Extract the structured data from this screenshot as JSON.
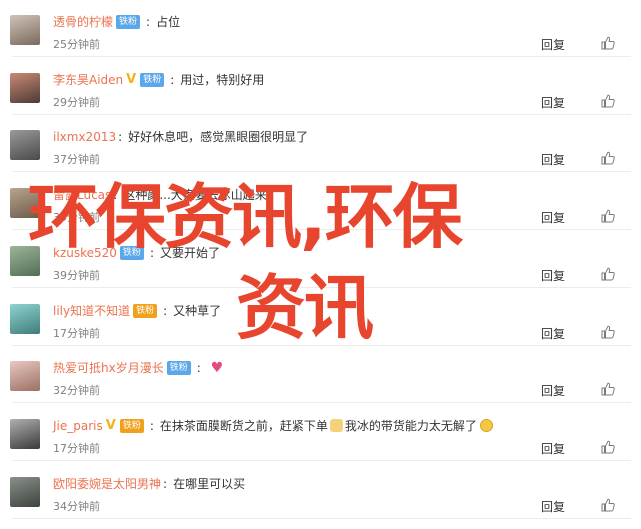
{
  "comments": [
    {
      "username": "透骨的柠檬",
      "badge": "铁粉",
      "text": "占位",
      "time": "25分钟前",
      "reply_label": "回复",
      "like_label": "",
      "avatar_colors": [
        "#cfc3b8",
        "#7b6a5d"
      ]
    },
    {
      "username": "李东昊Aiden",
      "vip": "V",
      "badge": "铁粉",
      "text": "用过，特别好用",
      "time": "29分钟前",
      "reply_label": "回复",
      "like_label": "",
      "avatar_colors": [
        "#c98a76",
        "#4e3a33"
      ]
    },
    {
      "username": "ilxmx2013",
      "text": "好好休息吧，感觉黑眼圈很明显了",
      "time": "37分钟前",
      "reply_label": "回复",
      "like_label": "",
      "avatar_colors": [
        "#9a9a9a",
        "#4a4a4a"
      ]
    },
    {
      "username": "雷露Lucas",
      "text": "这种颜...大家要去冰山起来",
      "time": "39分钟前",
      "reply_label": "回复",
      "like_label": "",
      "avatar_colors": [
        "#b7a490",
        "#6d5a48"
      ]
    },
    {
      "username": "kzuske520",
      "badge": "铁粉",
      "text": "又要开始了",
      "time": "39分钟前",
      "reply_label": "回复",
      "like_label": "",
      "avatar_colors": [
        "#9ab59a",
        "#546e55"
      ]
    },
    {
      "username": "lily知道不知道",
      "badge": "铁粉",
      "text": "又种草了",
      "time": "17分钟前",
      "reply_label": "回复",
      "like_label": "",
      "avatar_colors": [
        "#8fd3d0",
        "#3f7d7a"
      ]
    },
    {
      "username": "热爱可抵hx岁月漫长",
      "badge": "铁粉",
      "text": "",
      "time": "32分钟前",
      "reply_label": "回复",
      "like_label": "",
      "avatar_colors": [
        "#e8c9c0",
        "#9b6f64"
      ]
    },
    {
      "username": "Jie_paris",
      "vip": "V",
      "badge": "铁粉",
      "text": "在抹茶面膜断货之前，赶紧下单",
      "text2": "我冰的带货能力太无解了",
      "time": "17分钟前",
      "reply_label": "回复",
      "like_label": "",
      "avatar_colors": [
        "#b0b0b0",
        "#3a3a3a"
      ]
    },
    {
      "username": "欧阳委婉是太阳男神",
      "text": "在哪里可以买",
      "time": "34分钟前",
      "reply_label": "回复",
      "like_label": "",
      "avatar_colors": [
        "#8a8f8a",
        "#3d433d"
      ]
    }
  ],
  "overlay": {
    "line1": "环保资讯,环保",
    "line2": "资讯"
  },
  "colors": {
    "username": "#eb7350",
    "overlay_text": "#e8452e",
    "badge_blue": "#5aa7e9",
    "badge_gold": "#f0a11c"
  }
}
